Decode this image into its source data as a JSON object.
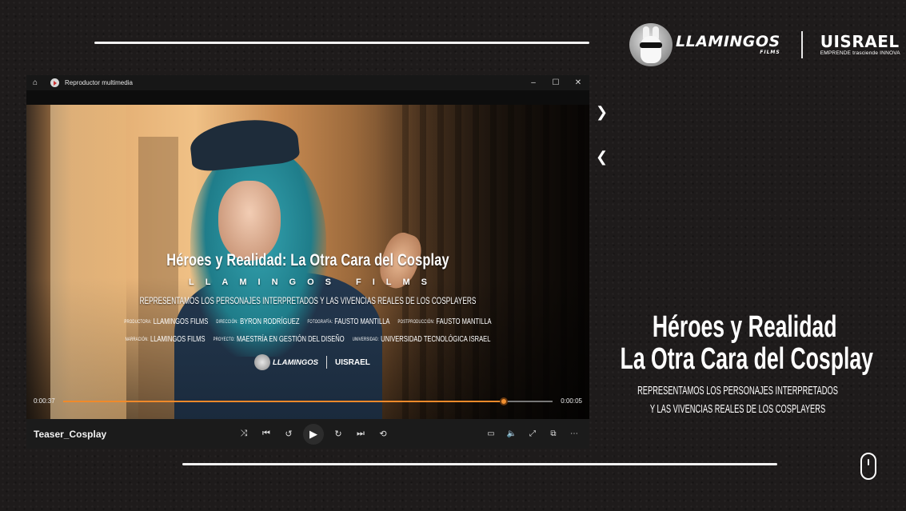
{
  "brand": {
    "llama_word": "LLAMINGOS",
    "llama_sub": "FILMS",
    "university": "UISRAEL",
    "university_tagline": "EMPRENDE trasciende INNOVA"
  },
  "player": {
    "window_title": "Reproductor multimedia",
    "media_title": "Teaser_Cosplay",
    "time_current": "0:00:37",
    "time_end": "0:00:05",
    "progress": 0.9,
    "video_overlay": {
      "title": "Héroes y Realidad: La Otra Cara del Cosplay",
      "studio": "LLAMINGOS FILMS",
      "tagline": "REPRESENTAMOS LOS PERSONAJES INTERPRETADOS Y LAS VIVENCIAS REALES DE LOS COSPLAYERS",
      "credits_row1": [
        {
          "label": "PRODUCTORA:",
          "value": "LLAMINGOS FILMS"
        },
        {
          "label": "DIRECCIÓN:",
          "value": "BYRON RODRÍGUEZ"
        },
        {
          "label": "FOTOGRAFÍA:",
          "value": "FAUSTO MANTILLA"
        },
        {
          "label": "POSTPRODUCCIÓN:",
          "value": "FAUSTO MANTILLA"
        }
      ],
      "credits_row2": [
        {
          "label": "NARRACIÓN:",
          "value": "LLAMINGOS FILMS"
        },
        {
          "label": "PROYECTO:",
          "value": "MAESTRÍA EN GESTIÓN DEL DISEÑO"
        },
        {
          "label": "UNIVERSIDAD:",
          "value": "UNIVERSIDAD TECNOLÓGICA ISRAEL"
        }
      ],
      "logo_llama": "LLAMINGOS",
      "logo_uisrael": "UISRAEL"
    },
    "icons": {
      "home": "home-icon",
      "app": "media-player-icon",
      "minimize": "minimize-icon",
      "maximize": "maximize-icon",
      "close": "close-icon"
    }
  },
  "slide": {
    "title_line1": "Héroes y Realidad",
    "title_line2": "La Otra Cara del Cosplay",
    "subtitle_line1": "REPRESENTAMOS LOS PERSONAJES INTERPRETADOS",
    "subtitle_line2": "Y LAS VIVENCIAS REALES DE LOS COSPLAYERS"
  },
  "colors": {
    "accent": "#f08a2a",
    "background": "#1e1b1b"
  }
}
